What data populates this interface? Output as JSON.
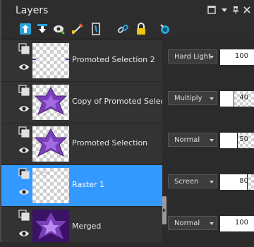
{
  "window": {
    "title": "Layers"
  },
  "colors": {
    "selected_row": "#3399ff",
    "panel_bg": "#2b2b2b",
    "row_bg": "#333333"
  },
  "titlebar_buttons": [
    {
      "icon": "maximize-icon"
    },
    {
      "icon": "dropdown-icon"
    },
    {
      "icon": "pin-icon"
    },
    {
      "icon": "close-icon"
    }
  ],
  "toolbar": [
    {
      "icon": "new-raster-layer-icon"
    },
    {
      "icon": "new-vector-layer-icon"
    },
    {
      "icon": "new-mask-layer-icon"
    },
    {
      "icon": "edit-selection-icon"
    },
    {
      "icon": "new-adjustment-layer-icon"
    },
    {
      "icon": "link-icon"
    },
    {
      "icon": "lock-icon"
    },
    {
      "icon": "show-hide-icon"
    }
  ],
  "layers": [
    {
      "name": "Promoted Selection 2",
      "blend_mode": "Hard Light",
      "opacity": 100,
      "selected": false,
      "thumb": "lines"
    },
    {
      "name": "Copy of Promoted Selection",
      "blend_mode": "Multiply",
      "opacity": 40,
      "selected": false,
      "thumb": "star"
    },
    {
      "name": "Promoted Selection",
      "blend_mode": "Normal",
      "opacity": 50,
      "selected": false,
      "thumb": "star"
    },
    {
      "name": "Raster 1",
      "blend_mode": "Screen",
      "opacity": 80,
      "selected": true,
      "thumb": "sketch"
    },
    {
      "name": "Merged",
      "blend_mode": "Normal",
      "opacity": 100,
      "selected": false,
      "thumb": "merged"
    }
  ]
}
